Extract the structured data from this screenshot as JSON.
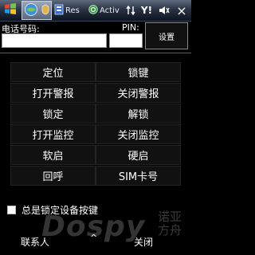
{
  "taskbar": {
    "tabs": [
      {
        "label": ""
      },
      {
        "label": "Res"
      },
      {
        "label": "Activ"
      }
    ],
    "tray": {
      "connection_icon": "connection-arrows-icon",
      "signal_text": "Y!",
      "volume_icon": "speaker-muted-icon",
      "close_glyph": "×"
    },
    "colors": {
      "accent": "#2b3444",
      "tab_active": "#7f8ba1"
    }
  },
  "form": {
    "phone_label": "电话号码:",
    "phone_value": "",
    "pin_label": "PIN:",
    "pin_value": "",
    "set_button": "设置"
  },
  "commands": [
    {
      "label": "定位"
    },
    {
      "label": "锁键"
    },
    {
      "label": "打开警报"
    },
    {
      "label": "关闭警报"
    },
    {
      "label": "锁定"
    },
    {
      "label": "解锁"
    },
    {
      "label": "打开监控"
    },
    {
      "label": "关闭监控"
    },
    {
      "label": "软启"
    },
    {
      "label": "硬启"
    },
    {
      "label": "回呼"
    },
    {
      "label": "SIM卡号"
    }
  ],
  "lock_checkbox": {
    "label": "总是锁定设备按键",
    "checked": false
  },
  "watermark": {
    "text": "Dospy",
    "cn": "诺亚方舟"
  },
  "softkeys": {
    "left": "联系人",
    "center": "^",
    "right": "关闭"
  }
}
